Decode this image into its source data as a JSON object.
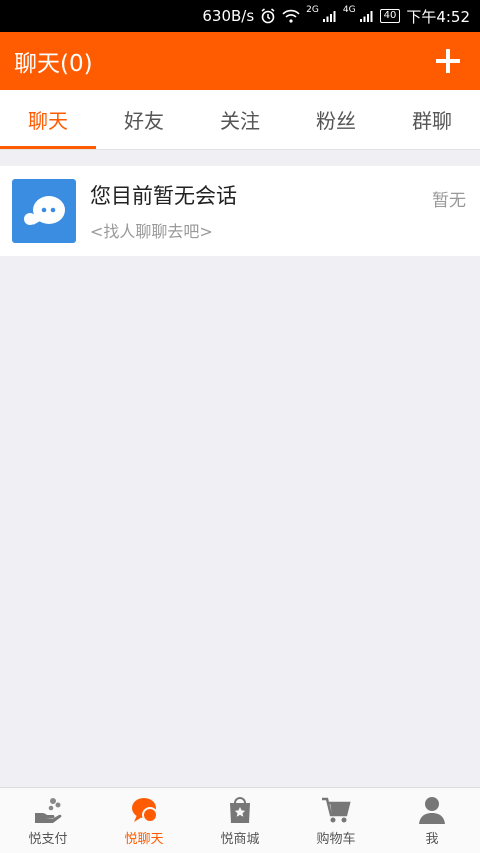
{
  "status_bar": {
    "network_speed": "630B/s",
    "signal_1": "2G",
    "signal_2": "4G",
    "battery": "40",
    "time": "下午4:52"
  },
  "app_bar": {
    "title": "聊天(0)",
    "action_icon": "plus-icon"
  },
  "tabs": [
    {
      "label": "聊天",
      "active": true
    },
    {
      "label": "好友",
      "active": false
    },
    {
      "label": "关注",
      "active": false
    },
    {
      "label": "粉丝",
      "active": false
    },
    {
      "label": "群聊",
      "active": false
    }
  ],
  "conversation": {
    "title": "您目前暂无会话",
    "subtitle": "<找人聊聊去吧>",
    "time": "暂无",
    "avatar_icon": "chat-bubble-icon"
  },
  "bottom_nav": [
    {
      "label": "悦支付",
      "icon": "hand-coins-icon",
      "active": false
    },
    {
      "label": "悦聊天",
      "icon": "chat-icon",
      "active": true
    },
    {
      "label": "悦商城",
      "icon": "shopping-bag-icon",
      "active": false
    },
    {
      "label": "购物车",
      "icon": "cart-icon",
      "active": false
    },
    {
      "label": "我",
      "icon": "person-icon",
      "active": false
    }
  ],
  "colors": {
    "accent": "#ff5b00",
    "avatar_blue": "#3b8de2",
    "background": "#efeff4"
  }
}
